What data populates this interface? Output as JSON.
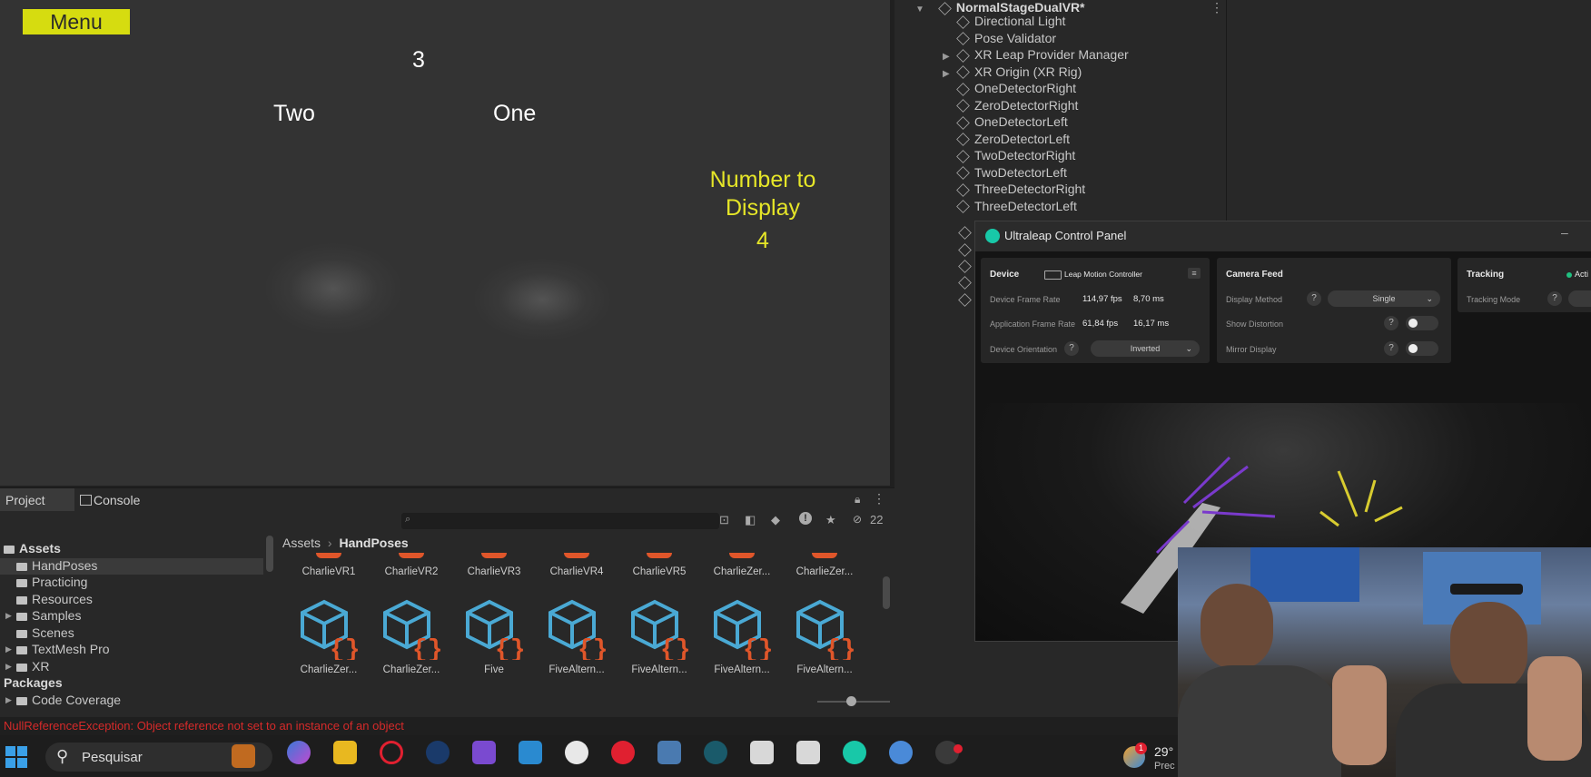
{
  "game": {
    "menu_label": "Menu",
    "count_value": "3",
    "label_left": "Two",
    "label_right": "One",
    "number_to_display_label": "Number to\nDisplay",
    "number_to_display_value": "4"
  },
  "hierarchy": {
    "scene_name": "NormalStageDualVR*",
    "items": [
      "Directional Light",
      "Pose Validator",
      "XR Leap Provider Manager",
      "XR Origin (XR Rig)",
      "OneDetectorRight",
      "ZeroDetectorRight",
      "OneDetectorLeft",
      "ZeroDetectorLeft",
      "TwoDetectorRight",
      "TwoDetectorLeft",
      "ThreeDetectorRight",
      "ThreeDetectorLeft"
    ]
  },
  "ultraleap": {
    "title": "Ultraleap Control Panel",
    "device": {
      "header": "Device",
      "device_name": "Leap Motion Controller",
      "frame_rate_label": "Device Frame Rate",
      "frame_rate_fps": "114,97 fps",
      "frame_rate_ms": "8,70 ms",
      "app_rate_label": "Application Frame Rate",
      "app_rate_fps": "61,84 fps",
      "app_rate_ms": "16,17 ms",
      "orientation_label": "Device Orientation",
      "orientation_value": "Inverted"
    },
    "camera": {
      "header": "Camera Feed",
      "display_method_label": "Display Method",
      "display_method_value": "Single",
      "show_distortion_label": "Show Distortion",
      "mirror_display_label": "Mirror Display"
    },
    "tracking": {
      "header": "Tracking",
      "status": "Acti",
      "mode_label": "Tracking Mode"
    }
  },
  "project": {
    "tabs": [
      "Project",
      "Console"
    ],
    "tree": [
      "Assets",
      "HandPoses",
      "Practicing",
      "Resources",
      "Samples",
      "Scenes",
      "TextMesh Pro",
      "XR",
      "Packages",
      "Code Coverage"
    ],
    "breadcrumb_root": "Assets",
    "breadcrumb_current": "HandPoses",
    "hidden_count": "22",
    "row1": [
      "CharlieVR1",
      "CharlieVR2",
      "CharlieVR3",
      "CharlieVR4",
      "CharlieVR5",
      "CharlieZer...",
      "CharlieZer..."
    ],
    "row2": [
      "CharlieZer...",
      "CharlieZer...",
      "Five",
      "FiveAltern...",
      "FiveAltern...",
      "FiveAltern...",
      "FiveAltern..."
    ],
    "error_message": "NullReferenceException: Object reference not set to an instance of an object"
  },
  "taskbar": {
    "search_label": "Pesquisar",
    "weather": "29°",
    "weather_sub": "Prec",
    "notification_count": "1"
  },
  "colors": {
    "menu_bg": "#d6dc10",
    "yellow_text": "#e6e628",
    "error_text": "#d62a2a",
    "asset_cube": "#4aa9d4",
    "asset_braces": "#e0562a"
  }
}
